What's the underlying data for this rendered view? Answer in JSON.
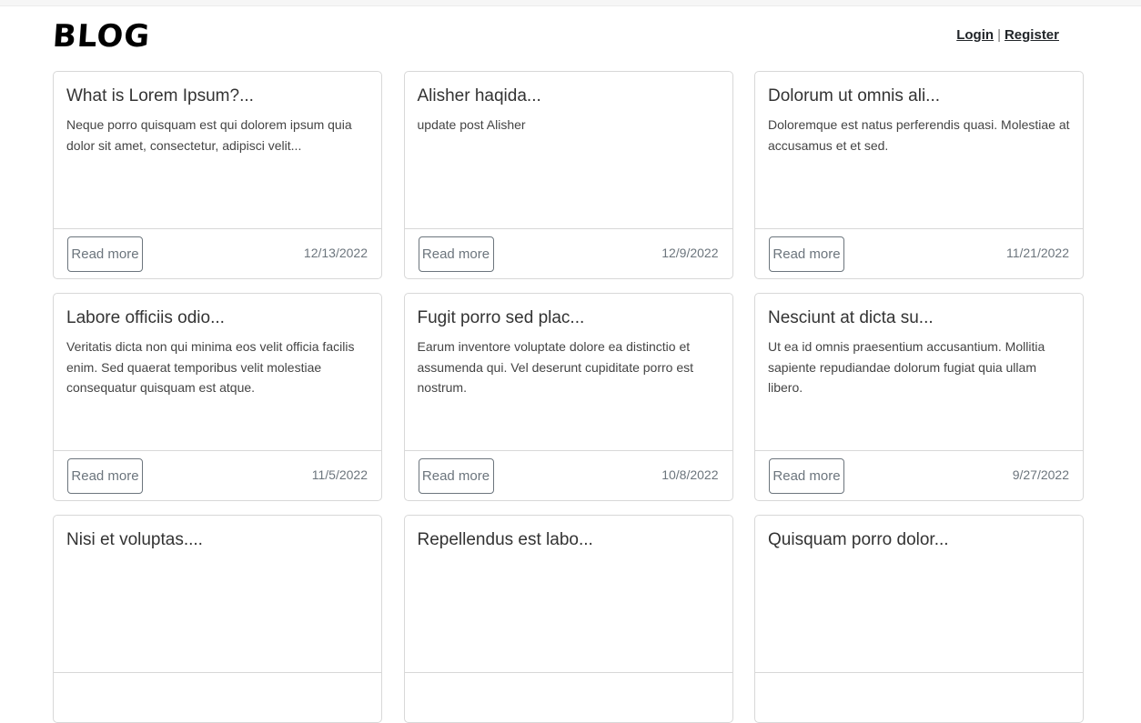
{
  "header": {
    "logo": "BLOG",
    "login": "Login",
    "separator": "|",
    "register": "Register"
  },
  "read_more_label": "Read more",
  "posts": [
    {
      "title": "What is Lorem Ipsum?...",
      "excerpt": "Neque porro quisquam est qui dolorem ipsum quia dolor sit amet, consectetur, adipisci velit...",
      "date": "12/13/2022"
    },
    {
      "title": "Alisher haqida...",
      "excerpt": "update post Alisher",
      "date": "12/9/2022"
    },
    {
      "title": "Dolorum ut omnis ali...",
      "excerpt": "Doloremque est natus perferendis quasi. Molestiae at accusamus et et sed.",
      "date": "11/21/2022"
    },
    {
      "title": "Labore officiis odio...",
      "excerpt": "Veritatis dicta non qui minima eos velit officia facilis enim. Sed quaerat temporibus velit molestiae consequatur quisquam est atque.",
      "date": "11/5/2022"
    },
    {
      "title": "Fugit porro sed plac...",
      "excerpt": "Earum inventore voluptate dolore ea distinctio et assumenda qui. Vel deserunt cupiditate porro est nostrum.",
      "date": "10/8/2022"
    },
    {
      "title": "Nesciunt at dicta su...",
      "excerpt": "Ut ea id omnis praesentium accusantium. Mollitia sapiente repudiandae dolorum fugiat quia ullam libero.",
      "date": "9/27/2022"
    },
    {
      "title": "Nisi et voluptas....",
      "excerpt": "",
      "date": ""
    },
    {
      "title": "Repellendus est labo...",
      "excerpt": "",
      "date": ""
    },
    {
      "title": "Quisquam porro dolor...",
      "excerpt": "",
      "date": ""
    }
  ]
}
